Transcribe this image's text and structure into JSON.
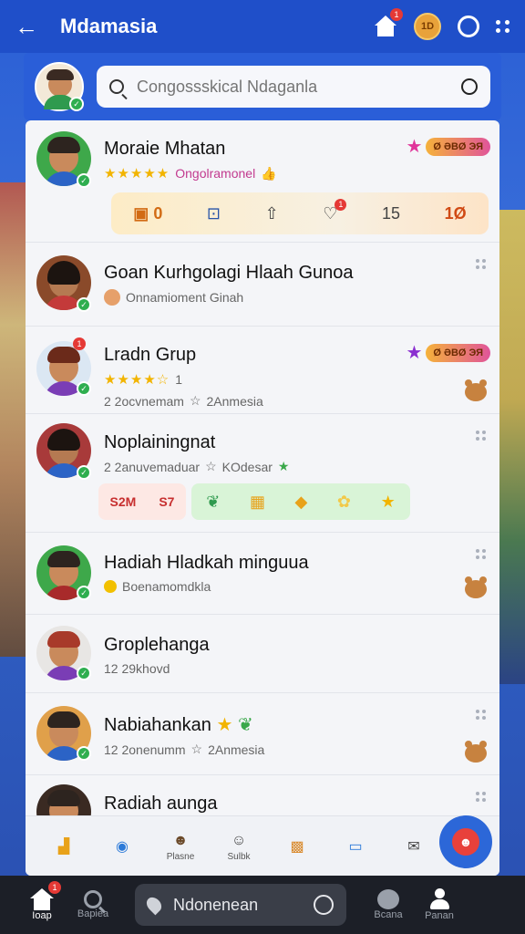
{
  "header": {
    "title": "Mdamasia",
    "back_icon": "arrow-left-icon",
    "home_badge": "1",
    "coin_label": "1D",
    "accent": "#1f4fc9"
  },
  "search": {
    "placeholder": "Congossskical Ndaganla"
  },
  "list": [
    {
      "name": "Moraie Mhatan",
      "sub_text": "Ongolramonel",
      "rating_stars": "★★★★★",
      "badge": "Ø ƏBØ ЭЯ",
      "actions": {
        "a1": "0",
        "a4_badge": "1",
        "a5": "15",
        "a6": "1Ø"
      }
    },
    {
      "name": "Goan Kurhgolagi Hlaah Gunoa",
      "sub_text": "Onnamioment Ginah"
    },
    {
      "name": "Lradn Grup",
      "sub_text": "1",
      "rating_stars": "★★★★☆",
      "meta_left": "2 2ocvnemam",
      "meta_right": "2Anmesia",
      "badge": "Ø ƏBØ ЭЯ",
      "avatar_badge": "1"
    },
    {
      "name": "Noplainingnat",
      "meta_left": "2 2anuvemaduar",
      "meta_right": "KOdesar",
      "gifts": {
        "g1a": "S2M",
        "g1b": "S7"
      }
    },
    {
      "name": "Hadiah Hladkah minguua",
      "sub_text": "Boenamomdkla"
    },
    {
      "name": "Groplehanga",
      "meta_left": "12 29khovd"
    },
    {
      "name": "Nabiahankan",
      "meta_left": "12 2onenumm",
      "meta_right": "2Anmesia"
    },
    {
      "name": "Radiah aunga"
    }
  ],
  "quickbar": {
    "item3": "Plasne",
    "item4": "Sulbk"
  },
  "bottomnav": {
    "home": "Ioap",
    "search": "Bapiea",
    "pill": "Ndonenean",
    "chat": "Bcana",
    "profile": "Panan",
    "home_badge": "1"
  }
}
